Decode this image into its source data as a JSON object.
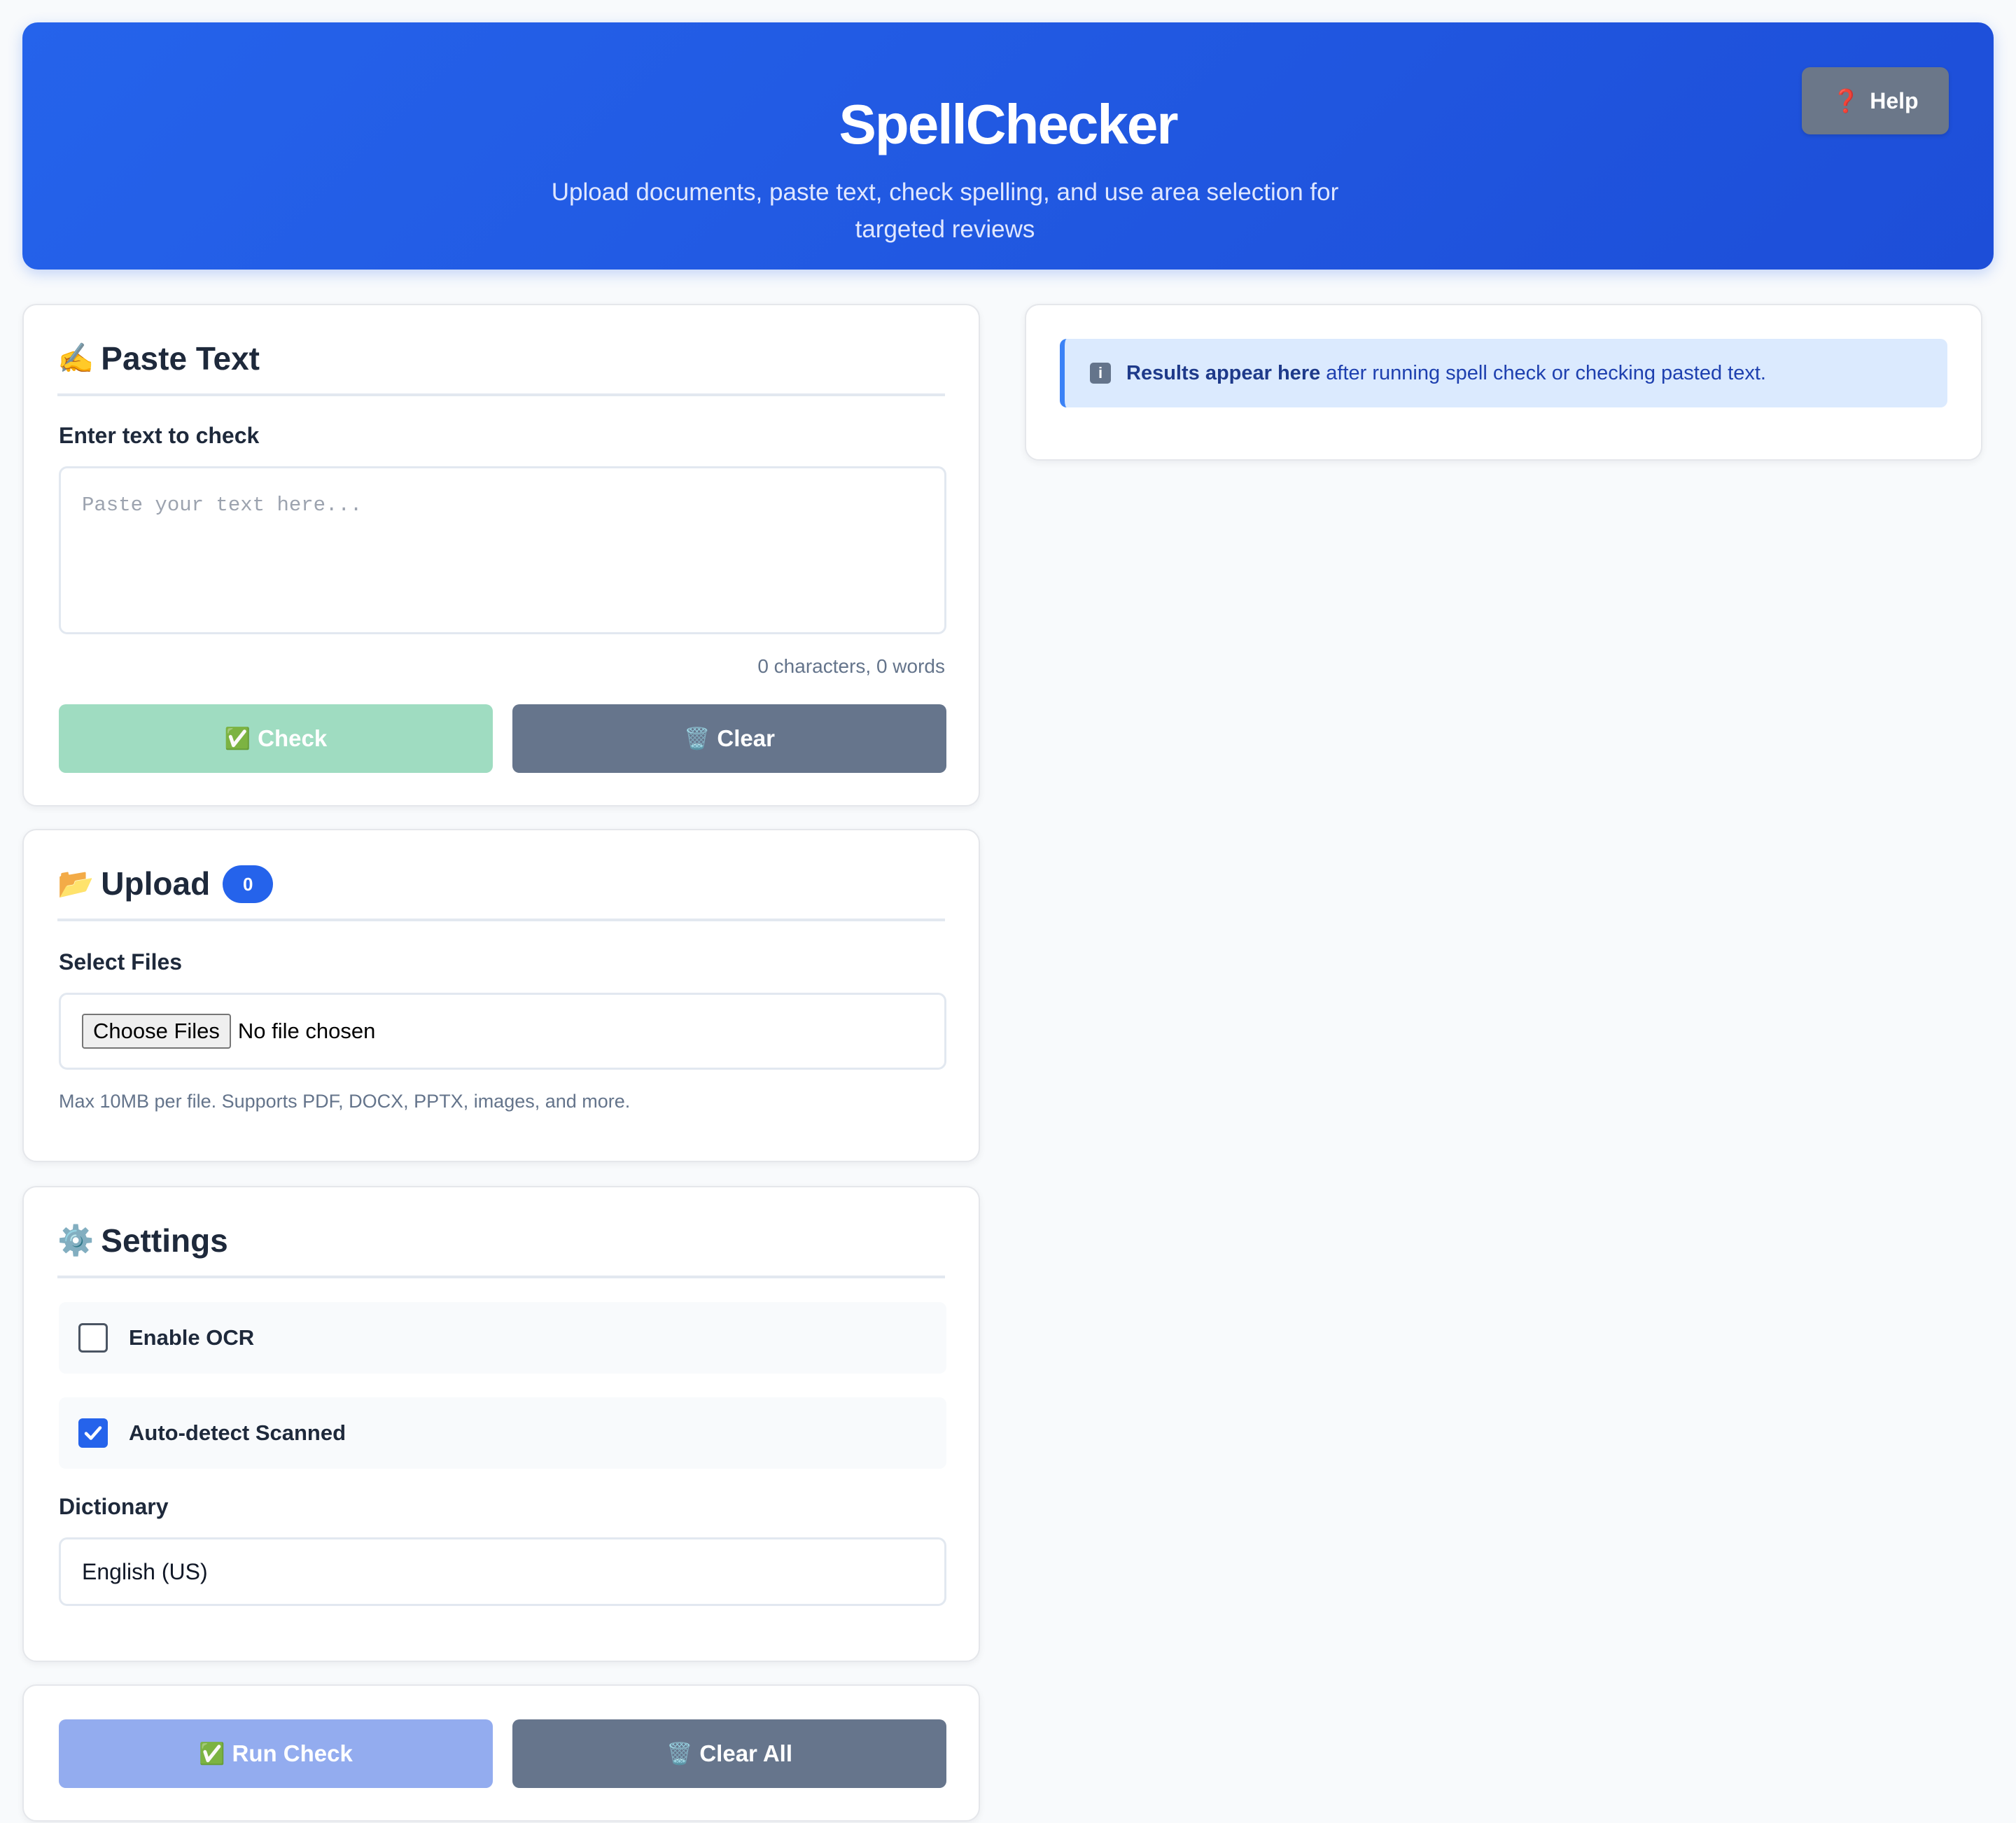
{
  "header": {
    "title": "SpellChecker",
    "subtitle": "Upload documents, paste text, check spelling, and use area selection for targeted reviews",
    "help_label": "Help",
    "help_icon": "❓"
  },
  "paste": {
    "icon": "✍️",
    "title": "Paste Text",
    "label": "Enter text to check",
    "placeholder": "Paste your text here...",
    "value": "",
    "counter": "0 characters, 0 words",
    "check_icon": "✅",
    "check_label": "Check",
    "clear_icon": "🗑️",
    "clear_label": "Clear"
  },
  "upload": {
    "icon": "📂",
    "title": "Upload",
    "count": "0",
    "label": "Select Files",
    "choose_label": "Choose Files",
    "no_file": "No file chosen",
    "hint": "Max 10MB per file. Supports PDF, DOCX, PPTX, images, and more."
  },
  "settings": {
    "icon": "⚙️",
    "title": "Settings",
    "ocr_label": "Enable OCR",
    "ocr_checked": false,
    "autodetect_label": "Auto-detect Scanned",
    "autodetect_checked": true,
    "dictionary_label": "Dictionary",
    "dictionary_value": "English (US)"
  },
  "actions": {
    "run_icon": "✅",
    "run_label": "Run Check",
    "clear_all_icon": "🗑️",
    "clear_all_label": "Clear All"
  },
  "results": {
    "icon": "ℹ️",
    "bold": "Results appear here",
    "rest": " after running spell check or checking pasted text."
  },
  "colors": {
    "primary": "#2563eb",
    "success_disabled": "#9fdcc1",
    "secondary": "#66758c",
    "info_bg": "#dbeafe"
  }
}
